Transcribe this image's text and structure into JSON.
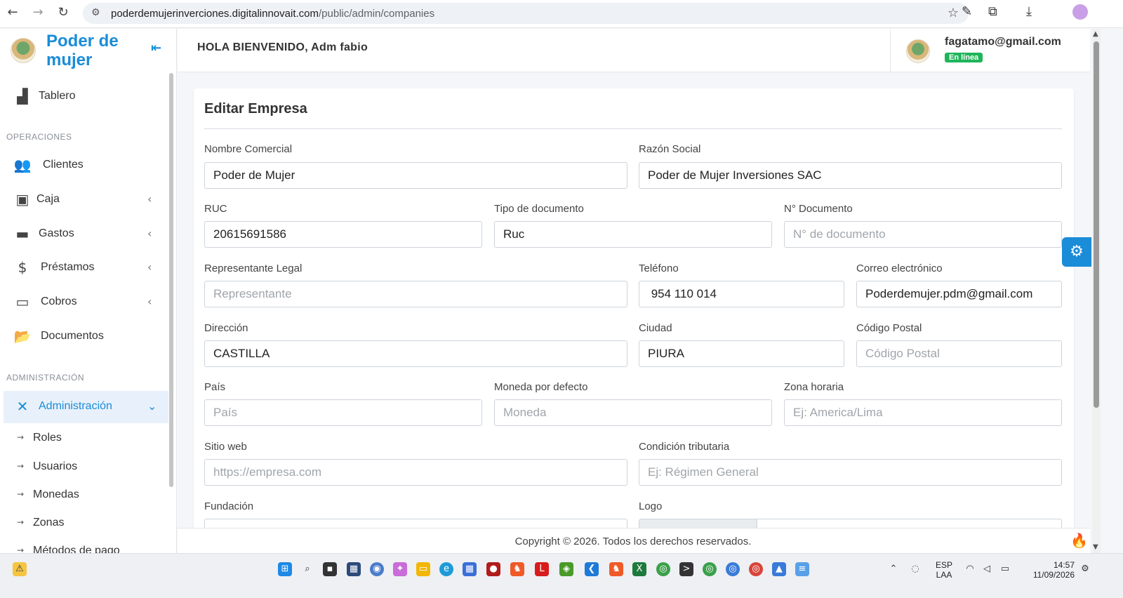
{
  "browser": {
    "url_domain": "poderdemujerinverciones.digitalinnovait.com",
    "url_path": "/public/admin/companies"
  },
  "sidebar": {
    "brand": "Poder de mujer",
    "dashboard": "Tablero",
    "section_operations": "OPERACIONES",
    "operations": [
      "Clientes",
      "Caja",
      "Gastos",
      "Préstamos",
      "Cobros",
      "Documentos"
    ],
    "section_admin": "ADMINISTRACIÓN",
    "admin_label": "Administración",
    "admin_items": [
      "Roles",
      "Usuarios",
      "Monedas",
      "Zonas",
      "Métodos de pago"
    ]
  },
  "topbar": {
    "welcome": "HOLA BIENVENIDO, Adm fabio",
    "user_email": "fagatamo@gmail.com",
    "user_status": "En línea"
  },
  "form": {
    "title": "Editar Empresa",
    "nombre_comercial": {
      "label": "Nombre Comercial",
      "value": "Poder de Mujer"
    },
    "razon_social": {
      "label": "Razón Social",
      "value": "Poder de Mujer Inversiones SAC"
    },
    "ruc": {
      "label": "RUC",
      "value": "20615691586"
    },
    "tipo_documento": {
      "label": "Tipo de documento",
      "value": "Ruc"
    },
    "num_documento": {
      "label": "N° Documento",
      "placeholder": "N° de documento"
    },
    "representante": {
      "label": "Representante Legal",
      "placeholder": "Representante"
    },
    "telefono": {
      "label": "Teléfono",
      "value": " 954 110 014"
    },
    "correo": {
      "label": "Correo electrónico",
      "value": "Poderdemujer.pdm@gmail.com"
    },
    "direccion": {
      "label": "Dirección",
      "value": "CASTILLA"
    },
    "ciudad": {
      "label": "Ciudad",
      "value": "PIURA"
    },
    "codigo_postal": {
      "label": "Código Postal",
      "placeholder": "Código Postal"
    },
    "pais": {
      "label": "País",
      "placeholder": "País"
    },
    "moneda": {
      "label": "Moneda por defecto",
      "placeholder": "Moneda"
    },
    "zona_horaria": {
      "label": "Zona horaria",
      "placeholder": "Ej: America/Lima"
    },
    "sitio_web": {
      "label": "Sitio web",
      "placeholder": "https://empresa.com"
    },
    "condicion": {
      "label": "Condición tributaria",
      "placeholder": "Ej: Régimen General"
    },
    "fundacion": {
      "label": "Fundación"
    },
    "logo": {
      "label": "Logo"
    }
  },
  "footer": "Copyright © 2026. Todos los derechos reservados.",
  "taskbar": {
    "lang_top": "ESP",
    "lang_bottom": "LAA",
    "time": "14:57",
    "date": "11/09/2026"
  },
  "colors": {
    "accent": "#1a8cd8",
    "status_green": "#1fb55a"
  }
}
